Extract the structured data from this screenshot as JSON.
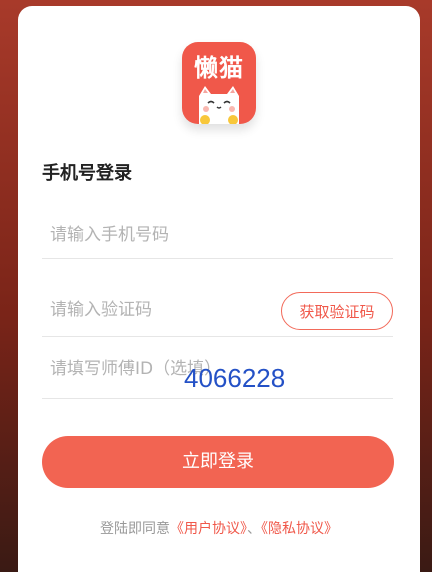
{
  "app": {
    "logo_text": "懒猫"
  },
  "form": {
    "title": "手机号登录",
    "phone_placeholder": "请输入手机号码",
    "code_placeholder": "请输入验证码",
    "get_code_label": "获取验证码",
    "master_id_placeholder": "请填写师傅ID（选填）",
    "login_label": "立即登录"
  },
  "overlay": {
    "number": "4066228"
  },
  "agreement": {
    "prefix": "登陆即同意",
    "user_agreement": "《用户协议》",
    "separator": "、",
    "privacy_agreement": "《隐私协议》"
  },
  "colors": {
    "accent": "#f0584a",
    "button": "#f26452",
    "overlay_text": "#2451c6"
  }
}
